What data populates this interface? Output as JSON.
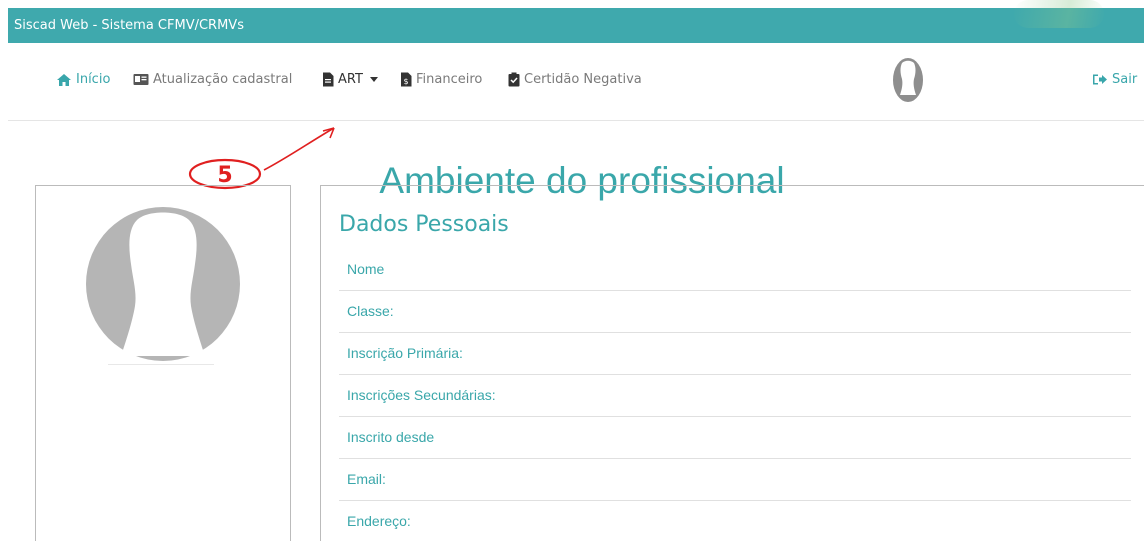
{
  "app": {
    "title": "Siscad Web - Sistema CFMV/CRMVs"
  },
  "nav": {
    "items": [
      {
        "label": "Início",
        "icon": "home-icon"
      },
      {
        "label": "Atualização cadastral",
        "icon": "id-card-icon"
      },
      {
        "label": "ART",
        "icon": "document-icon"
      },
      {
        "label": "Financeiro",
        "icon": "finance-icon"
      },
      {
        "label": "Certidão Negativa",
        "icon": "certificate-icon"
      }
    ],
    "exit_label": "Sair"
  },
  "annotation": {
    "step": "5"
  },
  "page": {
    "title": "Ambiente do profissional"
  },
  "personal": {
    "title": "Dados Pessoais",
    "fields": [
      "Nome",
      "Classe:",
      "Inscrição Primária:",
      "Inscrições Secundárias:",
      "Inscrito desde",
      "Email:",
      "Endereço:"
    ]
  },
  "colors": {
    "brand": "#3fa9ad",
    "accent": "#3aa7aa",
    "annotation": "#e02020"
  }
}
